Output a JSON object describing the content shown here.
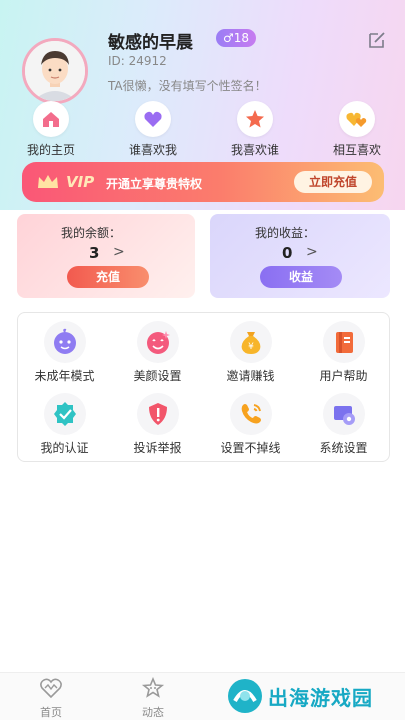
{
  "colors": {
    "vip_gradient_start": "#fa5777",
    "vip_gradient_end": "#fcbd73",
    "accent_purple": "#8a6ff2",
    "accent_red": "#f25a4f"
  },
  "profile": {
    "nickname": "敏感的早晨",
    "age_badge": "♂18",
    "user_id": "ID: 24912",
    "signature": "TA很懒，没有填写个性签名！"
  },
  "quick_actions": [
    {
      "label": "我的主页",
      "icon": "home-icon"
    },
    {
      "label": "谁喜欢我",
      "icon": "heart-icon"
    },
    {
      "label": "我喜欢谁",
      "icon": "star-icon"
    },
    {
      "label": "相互喜欢",
      "icon": "mutual-like-icon"
    }
  ],
  "vip": {
    "badge": "VIP",
    "text": "开通立享尊贵特权",
    "button": "立即充值"
  },
  "balance": {
    "title": "我的余额：",
    "value": "3",
    "arrow": ">",
    "button": "充值"
  },
  "income": {
    "title": "我的收益：",
    "value": "0",
    "arrow": ">",
    "button": "收益"
  },
  "features": [
    {
      "label": "未成年模式",
      "icon": "child-face-icon"
    },
    {
      "label": "美颜设置",
      "icon": "beauty-face-icon"
    },
    {
      "label": "邀请赚钱",
      "icon": "money-bag-icon"
    },
    {
      "label": "用户帮助",
      "icon": "help-book-icon"
    },
    {
      "label": "我的认证",
      "icon": "verified-badge-icon"
    },
    {
      "label": "投诉举报",
      "icon": "report-shield-icon"
    },
    {
      "label": "设置不掉线",
      "icon": "phone-call-icon"
    },
    {
      "label": "系统设置",
      "icon": "system-settings-icon"
    }
  ],
  "tabbar": {
    "home": "首页",
    "moments": "动态"
  },
  "watermark": {
    "text": "出海游戏园"
  }
}
